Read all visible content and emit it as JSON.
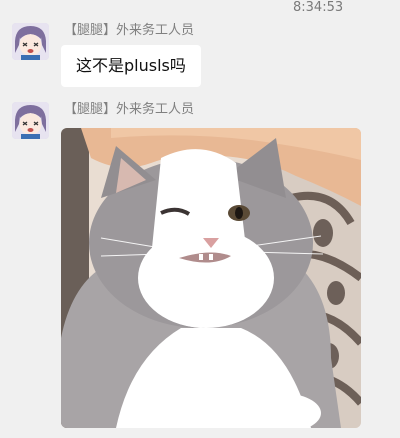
{
  "timestamp": "8:34:53",
  "messages": [
    {
      "sender": "【腿腿】外来务工人员",
      "type": "text",
      "text": "这不是plusls吗"
    },
    {
      "sender": "【腿腿】外来务工人员",
      "type": "image",
      "image_subject": "cat-photo"
    }
  ],
  "colors": {
    "background": "#f0f0f0",
    "bubble": "#ffffff",
    "sender_text": "#808080"
  }
}
